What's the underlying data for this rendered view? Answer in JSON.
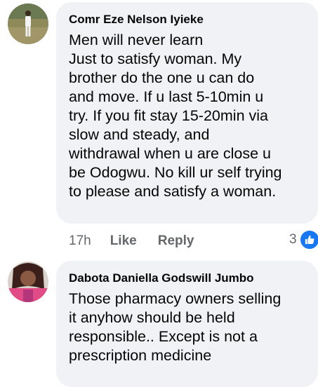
{
  "comments": [
    {
      "author": "Comr Eze Nelson Iyieke",
      "text": "Men will never learn\nJust to satisfy woman. My\nbrother do the one u can do\nand move. If u last 5-10min u\ntry. If you fit stay 15-20min via\nslow and steady, and\nwithdrawal when u are close u\nbe Odogwu. No kill ur self trying\nto please and satisfy a woman.",
      "time": "17h",
      "like_label": "Like",
      "reply_label": "Reply",
      "reaction_count": "3",
      "reaction_icon": "like-icon"
    },
    {
      "author": "Dabota Daniella Godswill Jumbo",
      "text": "Those pharmacy owners selling\nit anyhow should be held\nresponsible.. Except is not a\nprescription medicine"
    }
  ],
  "colors": {
    "bubble": "#f0f2f5",
    "action_text": "#65676b",
    "like_blue": "#1877f2"
  }
}
